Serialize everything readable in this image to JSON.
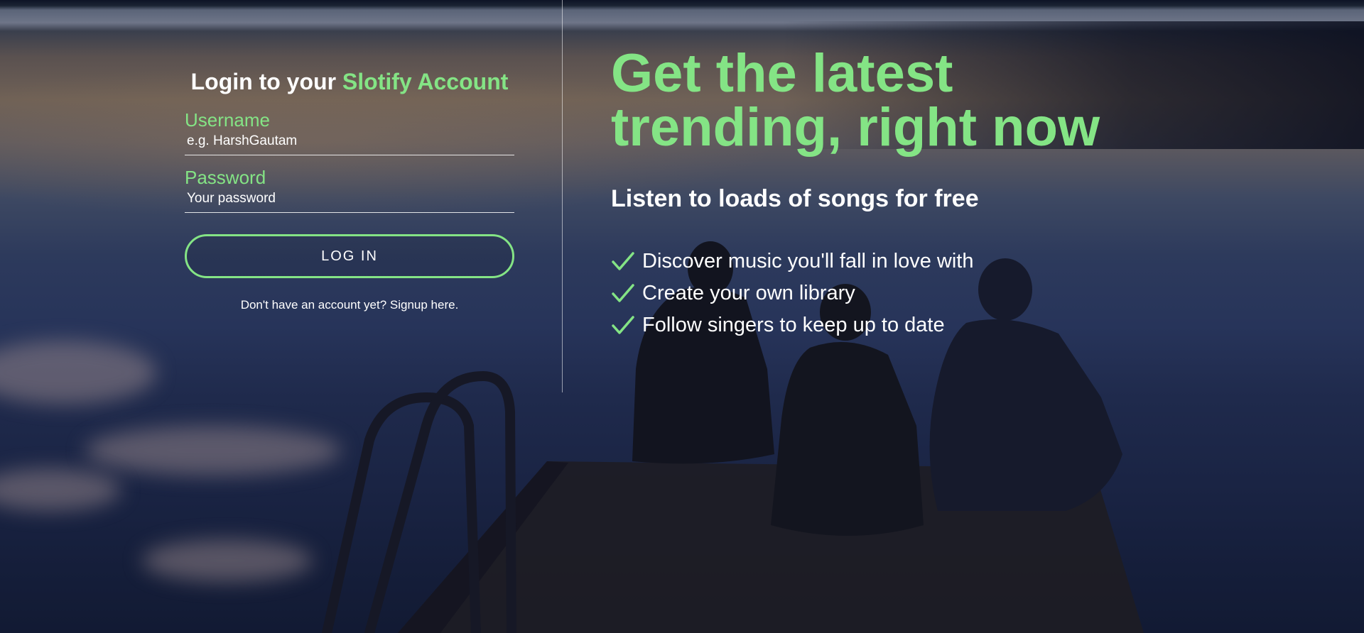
{
  "login": {
    "title_prefix": "Login to your ",
    "title_accent": "Slotify Account",
    "username_label": "Username",
    "username_placeholder": "e.g. HarshGautam",
    "password_label": "Password",
    "password_placeholder": "Your password",
    "button_label": "LOG IN",
    "signup_link": "Don't have an account yet? Signup here."
  },
  "promo": {
    "headline_line1": "Get the latest",
    "headline_line2": "trending, right now",
    "subtitle": "Listen to loads of songs for free",
    "features": [
      "Discover music you'll fall in love with",
      "Create your own library",
      "Follow singers to keep up to date"
    ],
    "feature_icon": "checkmark-icon"
  },
  "colors": {
    "accent": "#84e485",
    "text": "#ffffff"
  }
}
